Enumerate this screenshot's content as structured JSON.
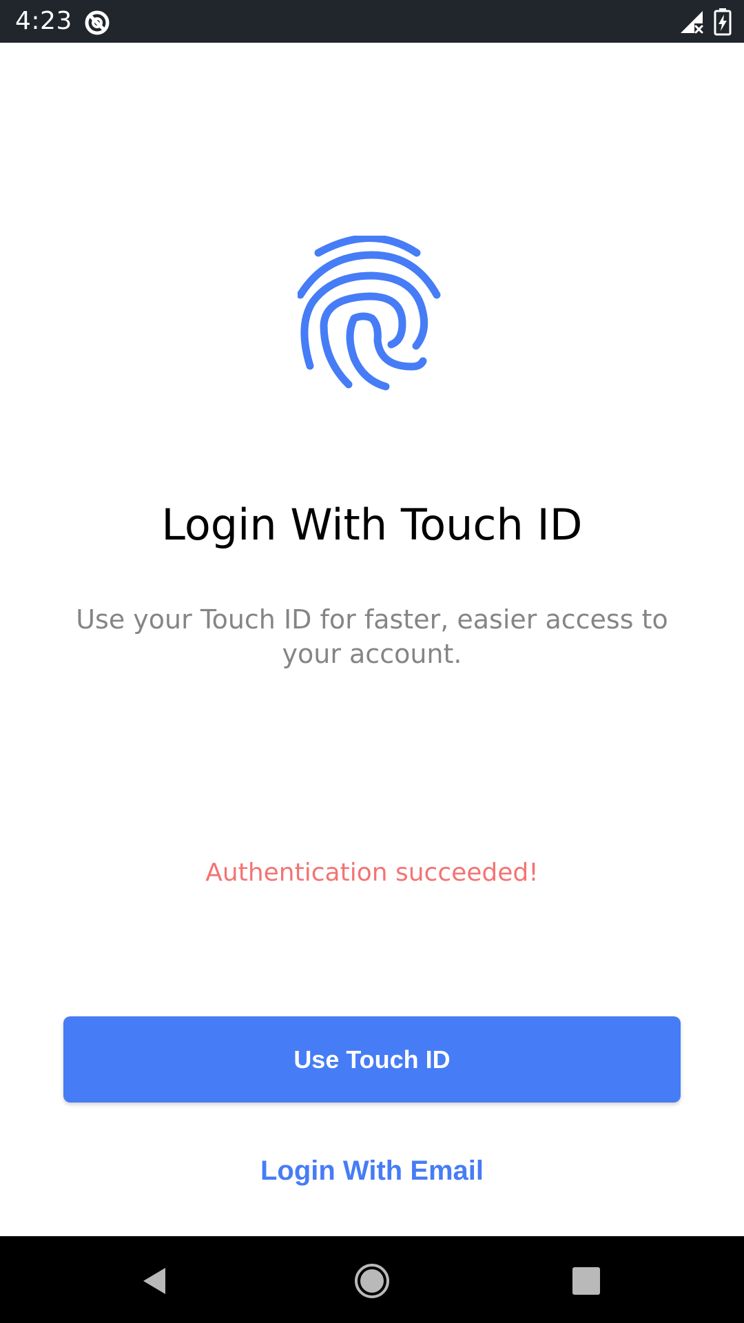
{
  "status_bar": {
    "time": "4:23",
    "icons": [
      "do-not-disturb-icon",
      "signal-no-data-icon",
      "battery-charging-icon"
    ]
  },
  "main": {
    "icon": "fingerprint-icon",
    "title": "Login With Touch ID",
    "subtitle": "Use your Touch ID for faster, easier access to your account.",
    "status_message": "Authentication succeeded!",
    "primary_button_label": "Use Touch ID",
    "secondary_button_label": "Login With Email"
  },
  "nav_bar": {
    "icons": [
      "back-icon",
      "home-icon",
      "recents-icon"
    ]
  },
  "colors": {
    "accent": "#467CF6",
    "status_text": "#F47373",
    "title": "#000000",
    "subtitle": "#858585",
    "status_bar_bg": "#21262C",
    "nav_bar_bg": "#000000"
  }
}
